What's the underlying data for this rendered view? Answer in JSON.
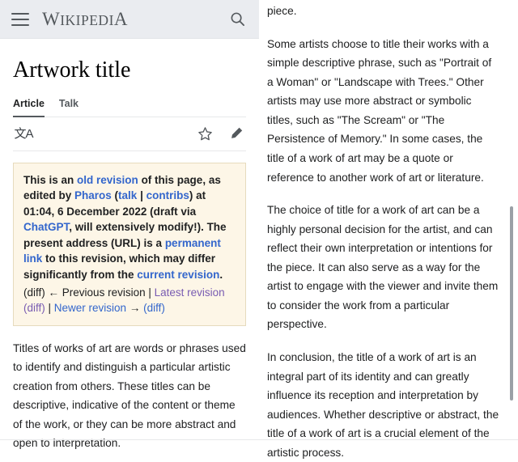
{
  "header": {
    "menu_icon": "hamburger-icon",
    "wordmark_full": "WIKIPEDIA",
    "wordmark_first": "W",
    "wordmark_rest": "IKIPEDI",
    "wordmark_last": "A",
    "search_icon": "search-icon",
    "background": "#eaecf0"
  },
  "article": {
    "title": "Artwork title",
    "tabs": [
      {
        "label": "Article",
        "active": true
      },
      {
        "label": "Talk",
        "active": false
      }
    ],
    "tools": {
      "language_icon": "language-icon",
      "language_glyph": "文A",
      "watch_icon": "star-icon",
      "edit_icon": "pencil-icon"
    }
  },
  "notice": {
    "background": "#fdf6e7",
    "border_color": "#e6dbbd",
    "link_color": "#3366cc",
    "visited_link_color": "#795cb2",
    "segments": [
      {
        "text": "This is an ",
        "type": "text"
      },
      {
        "text": "old revision",
        "type": "link"
      },
      {
        "text": " of this page, as edited by ",
        "type": "text"
      },
      {
        "text": "Pharos",
        "type": "link"
      },
      {
        "text": " (",
        "type": "text"
      },
      {
        "text": "talk",
        "type": "link"
      },
      {
        "text": " | ",
        "type": "text"
      },
      {
        "text": "contribs",
        "type": "link"
      },
      {
        "text": ") at 01:04, 6 December 2022 (draft via ",
        "type": "text"
      },
      {
        "text": "ChatGPT",
        "type": "link"
      },
      {
        "text": ", will extensively modify!). The present address (URL) is a ",
        "type": "text"
      },
      {
        "text": "permanent link",
        "type": "link"
      },
      {
        "text": " to this revision, which may differ significantly from the ",
        "type": "text"
      },
      {
        "text": "current revision",
        "type": "link"
      },
      {
        "text": ".",
        "type": "text"
      }
    ],
    "text_plain": "This is an old revision of this page, as edited by Pharos (talk | contribs) at 01:04, 6 December 2022 (draft via ChatGPT, will extensively modify!). The present address (URL) is a permanent link to this revision, which may differ significantly from the current revision.",
    "link_old_revision": "old revision",
    "link_user": "Pharos",
    "link_talk": "talk",
    "link_contribs": "contribs",
    "link_chatgpt": "ChatGPT",
    "link_permanent": "permanent link",
    "link_current": "current revision",
    "timestamp": "01:04, 6 December 2022",
    "edit_summary": "draft via ChatGPT, will extensively modify!",
    "nav": {
      "diff_open": "(diff)",
      "arrow_prev": "←",
      "previous_revision": "Previous revision",
      "sep1": " | ",
      "latest_revision": "Latest revision",
      "latest_diff": "(diff)",
      "sep2": " | ",
      "newer_revision": "Newer revision",
      "arrow_next": "→",
      "newer_diff": "(diff)"
    }
  },
  "body": {
    "left_paragraphs": [
      "Titles of works of art are words or phrases used to identify and distinguish a particular artistic creation from others. These titles can be descriptive, indicative of the content or theme of the work, or they can be more abstract and open to interpretation."
    ],
    "right_paragraphs": [
      "piece.",
      "Some artists choose to title their works with a simple descriptive phrase, such as \"Portrait of a Woman\" or \"Landscape with Trees.\" Other artists may use more abstract or symbolic titles, such as \"The Scream\" or \"The Persistence of Memory.\" In some cases, the title of a work of art may be a quote or reference to another work of art or literature.",
      "The choice of title for a work of art can be a highly personal decision for the artist, and can reflect their own interpretation or intentions for the piece. It can also serve as a way for the artist to engage with the viewer and invite them to consider the work from a particular perspective.",
      "In conclusion, the title of a work of art is an integral part of its identity and can greatly influence its reception and interpretation by audiences. Whether descriptive or abstract, the title of a work of art is a crucial element of the artistic process."
    ]
  },
  "scrollbar": {
    "name": "vertical-scrollbar",
    "color": "#9aa0a6"
  }
}
